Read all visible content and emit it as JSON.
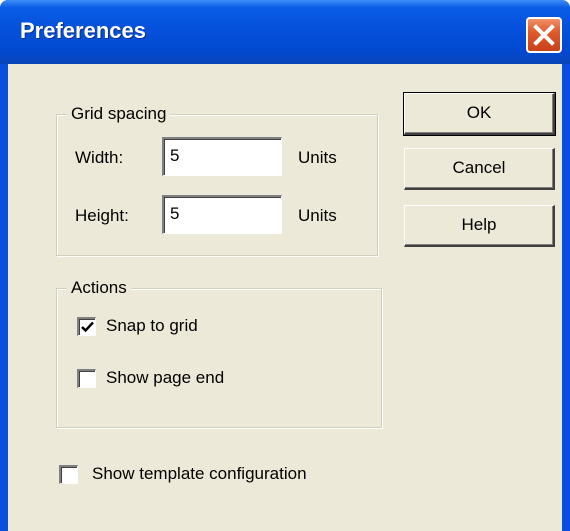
{
  "window": {
    "title": "Preferences",
    "close_icon": "close-icon"
  },
  "grid_spacing": {
    "label": "Grid spacing",
    "width_label": "Width:",
    "width_value": "5",
    "width_unit": "Units",
    "height_label": "Height:",
    "height_value": "5",
    "height_unit": "Units"
  },
  "actions": {
    "label": "Actions",
    "snap_to_grid": {
      "label": "Snap to grid",
      "checked": true
    },
    "show_page_end": {
      "label": "Show page end",
      "checked": false
    }
  },
  "show_template_configuration": {
    "label": "Show template configuration",
    "checked": false
  },
  "buttons": {
    "ok": "OK",
    "cancel": "Cancel",
    "help": "Help"
  },
  "colors": {
    "titlebar": "#0551db",
    "client": "#ece9d8",
    "close_button": "#e05a2c"
  }
}
